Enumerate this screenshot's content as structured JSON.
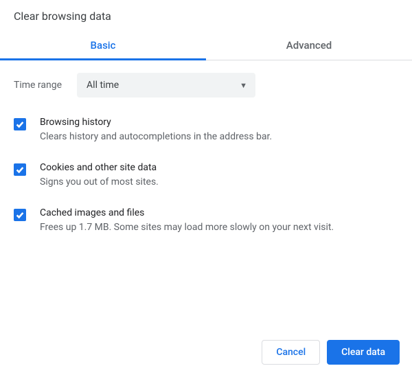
{
  "dialog": {
    "title": "Clear browsing data"
  },
  "tabs": {
    "basic": "Basic",
    "advanced": "Advanced",
    "active": "basic"
  },
  "time_range": {
    "label": "Time range",
    "value": "All time"
  },
  "options": [
    {
      "title": "Browsing history",
      "desc": "Clears history and autocompletions in the address bar.",
      "checked": true
    },
    {
      "title": "Cookies and other site data",
      "desc": "Signs you out of most sites.",
      "checked": true
    },
    {
      "title": "Cached images and files",
      "desc": "Frees up 1.7 MB. Some sites may load more slowly on your next visit.",
      "checked": true
    }
  ],
  "footer": {
    "cancel": "Cancel",
    "confirm": "Clear data"
  }
}
